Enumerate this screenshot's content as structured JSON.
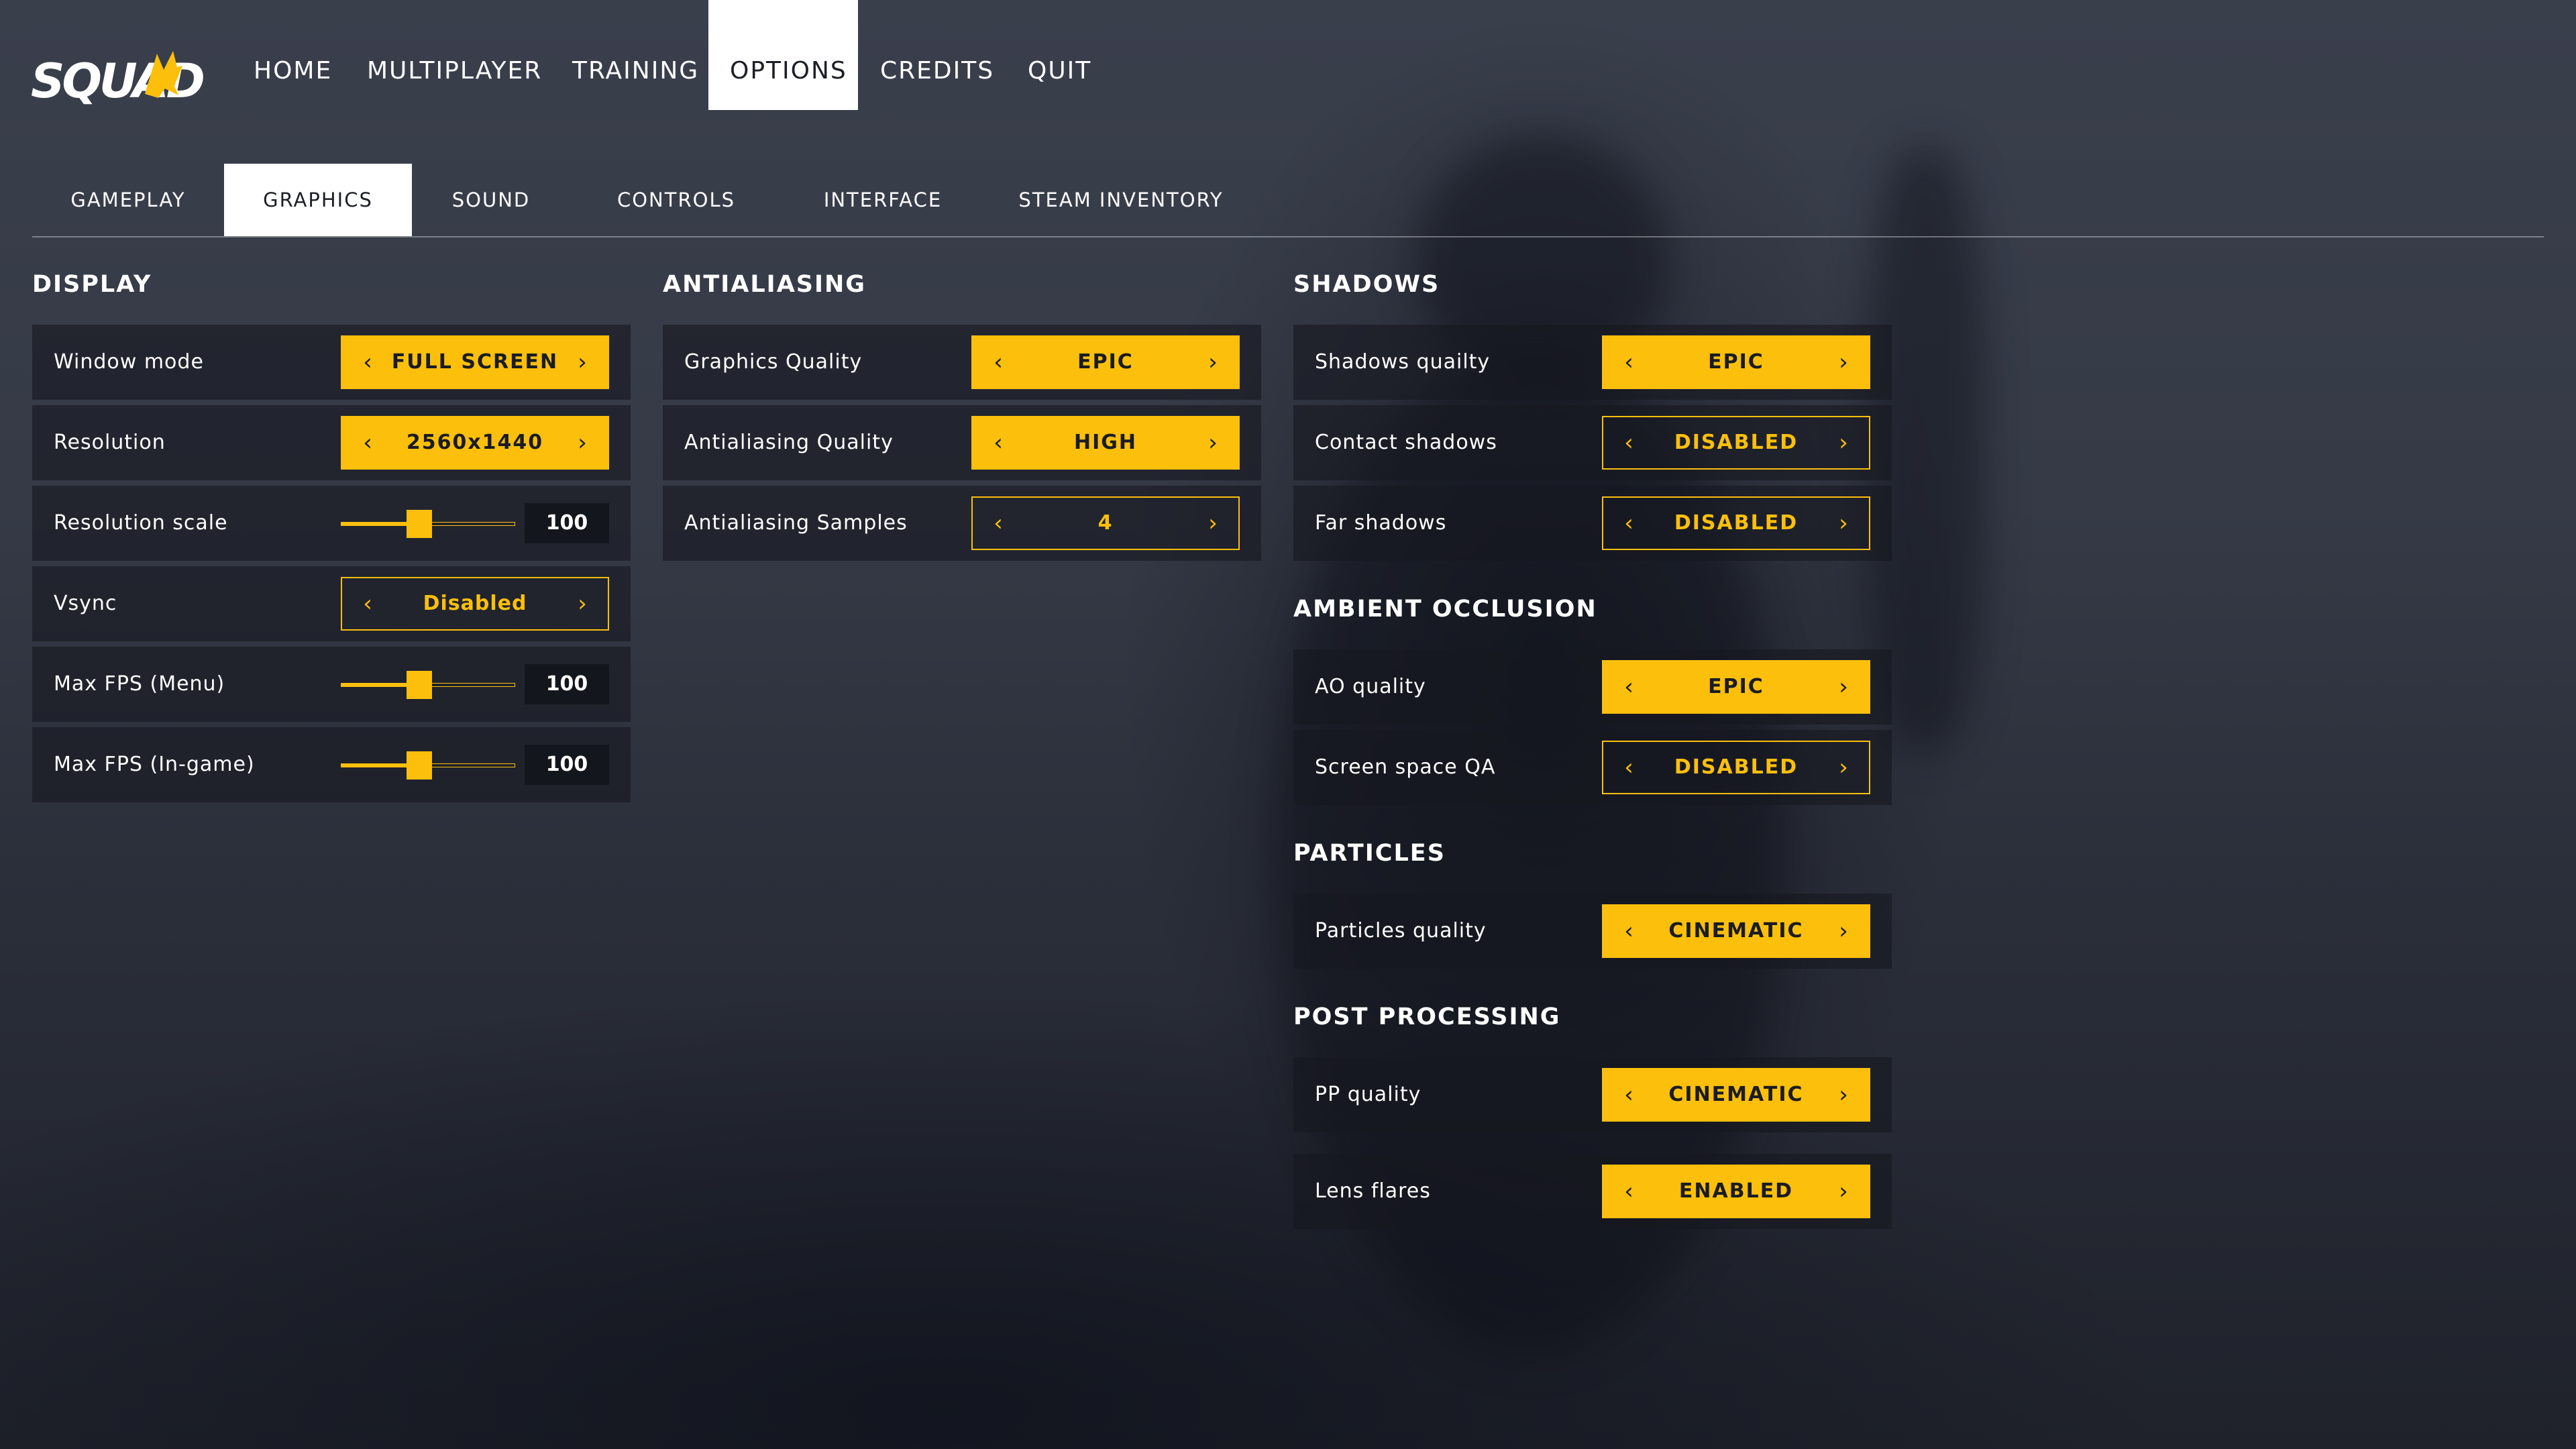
{
  "nav": {
    "logo": "SQUAD",
    "items": [
      {
        "label": "HOME",
        "active": false
      },
      {
        "label": "MULTIPLAYER",
        "active": false
      },
      {
        "label": "TRAINING",
        "active": false
      },
      {
        "label": "OPTIONS",
        "active": true
      },
      {
        "label": "CREDITS",
        "active": false
      },
      {
        "label": "QUIT",
        "active": false
      }
    ]
  },
  "tabs": [
    {
      "label": "GAMEPLAY",
      "active": false
    },
    {
      "label": "GRAPHICS",
      "active": true
    },
    {
      "label": "SOUND",
      "active": false
    },
    {
      "label": "CONTROLS",
      "active": false
    },
    {
      "label": "INTERFACE",
      "active": false
    },
    {
      "label": "STEAM INVENTORY",
      "active": false
    }
  ],
  "colors": {
    "accent": "#fbbf0c",
    "panel": "#161921",
    "active_tab": "#ffffff"
  },
  "display": {
    "heading": "DISPLAY",
    "window_mode": {
      "label": "Window mode",
      "value": "FULL SCREEN"
    },
    "resolution": {
      "label": "Resolution",
      "value": "2560x1440"
    },
    "resolution_scale": {
      "label": "Resolution scale",
      "value": "100",
      "level": 0.45
    },
    "vsync": {
      "label": "Vsync",
      "value": "Disabled"
    },
    "max_fps_menu": {
      "label": "Max FPS (Menu)",
      "value": "100",
      "level": 0.45
    },
    "max_fps_ingame": {
      "label": "Max FPS (In-game)",
      "value": "100",
      "level": 0.45
    }
  },
  "antialiasing": {
    "heading": "ANTIALIASING",
    "graphics_quality": {
      "label": "Graphics Quality",
      "value": "EPIC"
    },
    "aa_quality": {
      "label": "Antialiasing Quality",
      "value": "HIGH"
    },
    "aa_samples": {
      "label": "Antialiasing Samples",
      "value": "4"
    }
  },
  "shadows": {
    "heading": "SHADOWS",
    "shadows_quality": {
      "label": "Shadows quailty",
      "value": "EPIC"
    },
    "contact_shadows": {
      "label": "Contact shadows",
      "value": "DISABLED"
    },
    "far_shadows": {
      "label": "Far shadows",
      "value": "DISABLED"
    }
  },
  "ambient_occlusion": {
    "heading": "AMBIENT OCCLUSION",
    "ao_quality": {
      "label": "AO quality",
      "value": "EPIC"
    },
    "ssao": {
      "label": "Screen space QA",
      "value": "DISABLED"
    }
  },
  "particles": {
    "heading": "PARTICLES",
    "particles_quality": {
      "label": "Particles quality",
      "value": "CINEMATIC"
    }
  },
  "post_processing": {
    "heading": "POST PROCESSING",
    "pp_quality": {
      "label": "PP quality",
      "value": "CINEMATIC"
    },
    "lens_flares": {
      "label": "Lens flares",
      "value": "ENABLED"
    }
  },
  "icons": {
    "prev": "chevron-left-icon",
    "next": "chevron-right-icon"
  }
}
